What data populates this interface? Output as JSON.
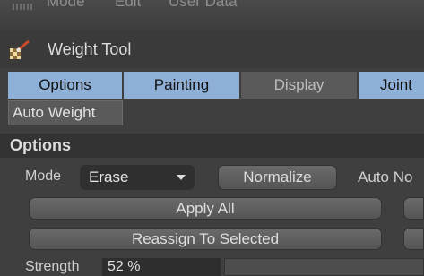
{
  "menubar": {
    "items": [
      "Mode",
      "Edit",
      "User Data"
    ]
  },
  "title": "Weight Tool",
  "tabs": [
    "Options",
    "Painting",
    "Display",
    "Joint"
  ],
  "subtab": "Auto Weight",
  "section": "Options",
  "mode": {
    "label": "Mode",
    "value": "Erase"
  },
  "buttons": {
    "normalize": "Normalize",
    "auto_normalize": "Auto No",
    "apply_all": "Apply All",
    "reassign": "Reassign To Selected"
  },
  "strength": {
    "label": "Strength",
    "value": "52 %"
  },
  "colors": {
    "accent_tab": "#8fb0d6",
    "background": "#3f3f3f"
  },
  "icons": {
    "tool": "weight-brush-icon",
    "dropdown": "chevron-down-icon"
  }
}
